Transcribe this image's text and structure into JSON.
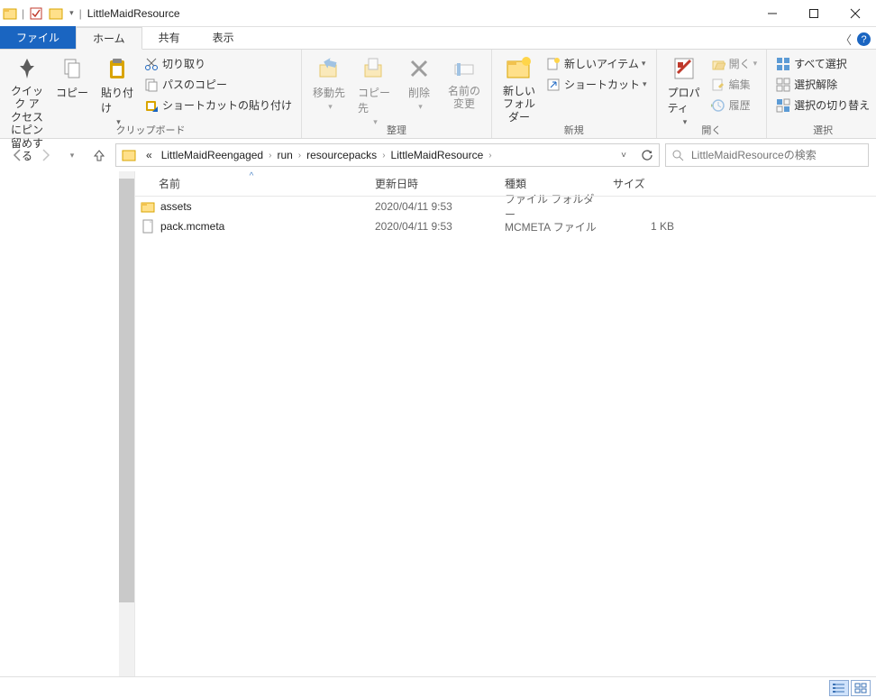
{
  "title": "LittleMaidResource",
  "tabs": {
    "file": "ファイル",
    "home": "ホーム",
    "share": "共有",
    "view": "表示"
  },
  "ribbon": {
    "pin": "クイック アクセス\nにピン留めする",
    "copy": "コピー",
    "paste": "貼り付け",
    "cut": "切り取り",
    "copypath": "パスのコピー",
    "pasteshortcut": "ショートカットの貼り付け",
    "grp_clip": "クリップボード",
    "moveto": "移動先",
    "copyto": "コピー先",
    "delete": "削除",
    "rename": "名前の\n変更",
    "grp_org": "整理",
    "newfolder": "新しい\nフォルダー",
    "newitem": "新しいアイテム",
    "shortcut": "ショートカット",
    "grp_new": "新規",
    "properties": "プロパティ",
    "open": "開く",
    "edit": "編集",
    "history": "履歴",
    "grp_open": "開く",
    "selectall": "すべて選択",
    "selectnone": "選択解除",
    "selectinvert": "選択の切り替え",
    "grp_sel": "選択"
  },
  "breadcrumb": {
    "root": "«",
    "p0": "LittleMaidReengaged",
    "p1": "run",
    "p2": "resourcepacks",
    "p3": "LittleMaidResource"
  },
  "search_placeholder": "LittleMaidResourceの検索",
  "columns": {
    "name": "名前",
    "date": "更新日時",
    "type": "種類",
    "size": "サイズ"
  },
  "rows": [
    {
      "icon": "folder",
      "name": "assets",
      "date": "2020/04/11 9:53",
      "type": "ファイル フォルダー",
      "size": ""
    },
    {
      "icon": "file",
      "name": "pack.mcmeta",
      "date": "2020/04/11 9:53",
      "type": "MCMETA ファイル",
      "size": "1 KB"
    }
  ]
}
